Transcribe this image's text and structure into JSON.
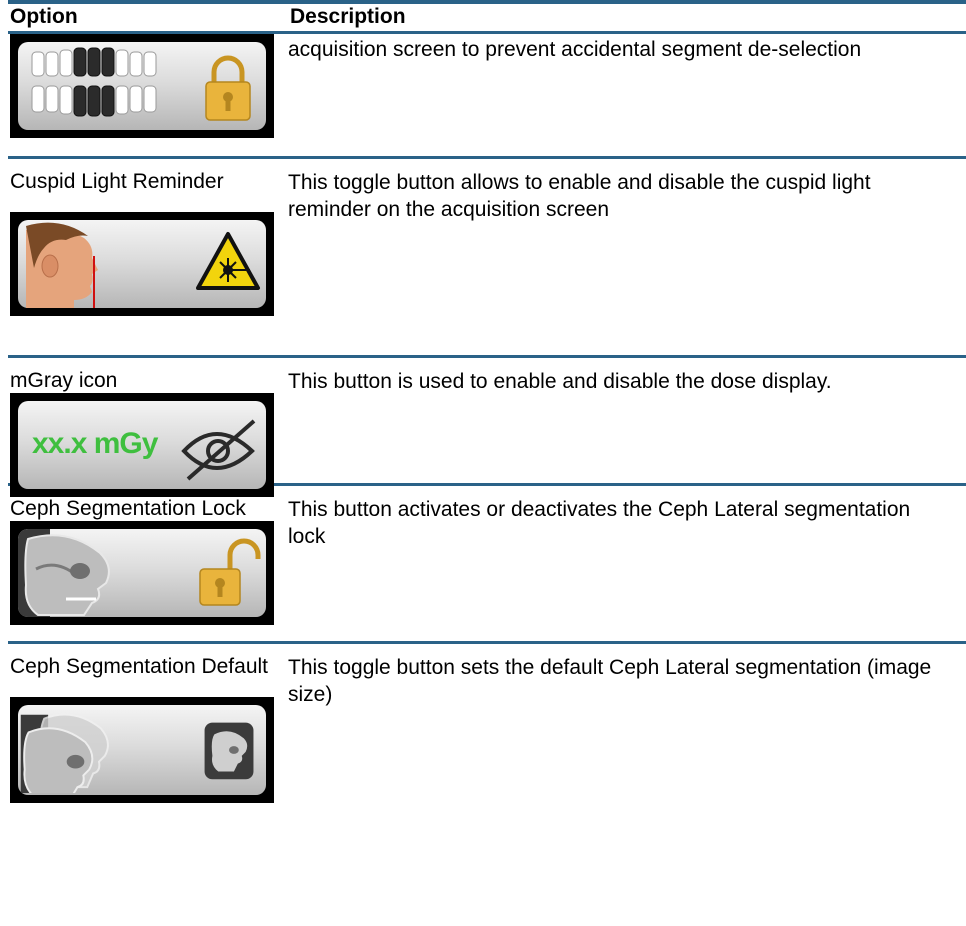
{
  "table": {
    "header": {
      "option": "Option",
      "description": "Description"
    },
    "rows": [
      {
        "option": "",
        "description": "acquisition screen to prevent accidental segment de-selection",
        "icon": "teeth-segment-lock-icon"
      },
      {
        "option": "Cuspid Light Reminder",
        "description": "This toggle button allows to enable and disable the cuspid light reminder on the acquisition screen",
        "icon": "laser-warning-icon"
      },
      {
        "option": "mGray icon",
        "description": "This button is used to enable and disable the dose display.",
        "icon": "dose-display-hidden-icon",
        "dose_text": "xx.x mGy"
      },
      {
        "option": "Ceph Segmentation Lock",
        "description": "This button activates or deactivates the Ceph Lateral segmentation lock",
        "icon": "ceph-unlock-icon"
      },
      {
        "option": "Ceph Segmentation Default",
        "description": "This toggle button sets the default Ceph Lateral segmentation (image size)",
        "icon": "ceph-default-icon"
      }
    ]
  },
  "colors": {
    "rule": "#2a6288",
    "lock_gold": "#e9b43c",
    "dose_green": "#3fbf3f",
    "laser_yellow": "#f2d40d"
  }
}
